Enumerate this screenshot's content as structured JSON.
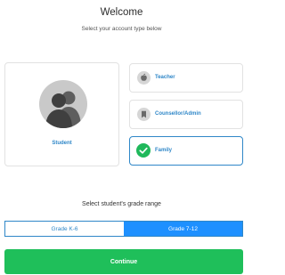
{
  "header": {
    "title": "Welcome",
    "subtitle": "Select your account type below"
  },
  "account_types": {
    "student": {
      "label": "Student",
      "icon": "students-silhouette-icon"
    },
    "options": [
      {
        "label": "Teacher",
        "icon": "apple-icon",
        "selected": false
      },
      {
        "label": "Counsellor/Admin",
        "icon": "bookmark-icon",
        "selected": false
      },
      {
        "label": "Family",
        "icon": "checkmark-icon",
        "selected": true
      }
    ]
  },
  "grade": {
    "heading": "Select student's grade range",
    "options": [
      {
        "label": "Grade K-6",
        "selected": false
      },
      {
        "label": "Grade 7-12",
        "selected": true
      }
    ]
  },
  "actions": {
    "continue_label": "Continue"
  },
  "colors": {
    "accent_blue": "#2f87c8",
    "segment_blue": "#1e90ff",
    "success_green": "#1fbf5a"
  }
}
